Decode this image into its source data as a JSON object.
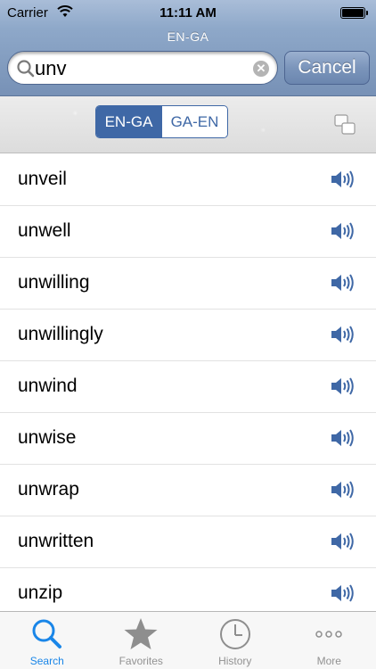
{
  "status_bar": {
    "carrier": "Carrier",
    "time": "11:11 AM"
  },
  "header": {
    "title": "EN-GA"
  },
  "search": {
    "query": "unv",
    "cancel_label": "Cancel"
  },
  "direction": {
    "options": [
      "EN-GA",
      "GA-EN"
    ],
    "selected": "EN-GA"
  },
  "words": [
    "unveil",
    "unwell",
    "unwilling",
    "unwillingly",
    "unwind",
    "unwise",
    "unwrap",
    "unwritten",
    "unzip"
  ],
  "tabs": [
    {
      "label": "Search",
      "icon": "search-icon",
      "active": true
    },
    {
      "label": "Favorites",
      "icon": "star-icon",
      "active": false
    },
    {
      "label": "History",
      "icon": "clock-icon",
      "active": false
    },
    {
      "label": "More",
      "icon": "more-icon",
      "active": false
    }
  ],
  "colors": {
    "accent": "#1a86e8",
    "segment": "#3f68a6",
    "header": "#7791b6"
  }
}
